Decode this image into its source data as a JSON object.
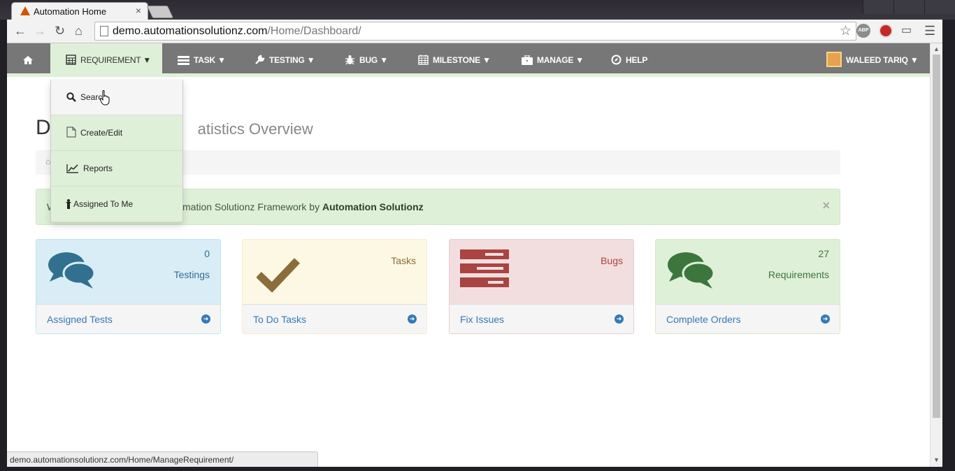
{
  "browser": {
    "tab_title": "Automation Home",
    "tab_close": "×",
    "url_host": "demo.automationsolutionz.com",
    "url_path": "/Home/Dashboard/",
    "ext_abp": "ABP",
    "status_url": "demo.automationsolutionz.com/Home/ManageRequirement/"
  },
  "nav": {
    "items": [
      {
        "label": "REQUIREMENT ▼",
        "icon": "calculator-icon"
      },
      {
        "label": "TASK ▼",
        "icon": "tasks-icon"
      },
      {
        "label": "TESTING ▼",
        "icon": "wrench-icon"
      },
      {
        "label": "BUG ▼",
        "icon": "bug-icon"
      },
      {
        "label": "MILESTONE  ▼",
        "icon": "calendar-icon"
      },
      {
        "label": "MANAGE ▼",
        "icon": "briefcase-icon"
      },
      {
        "label": "HELP",
        "icon": "compass-icon"
      }
    ],
    "user": "WALEED TARIQ ▼"
  },
  "dropdown": {
    "items": [
      {
        "label": "Search",
        "icon": "search-icon"
      },
      {
        "label": "Create/Edit",
        "icon": "file-icon"
      },
      {
        "label": "Reports",
        "icon": "line-chart-icon"
      },
      {
        "label": "Assigned To Me",
        "icon": "person-icon"
      }
    ]
  },
  "page": {
    "heading_visible": "D",
    "heading_sub_visible": "atistics Overview",
    "alert_prefix": "W",
    "alert_text": "omation Solutionz Framework by ",
    "alert_bold": "Automation Solutionz",
    "alert_close": "×"
  },
  "panels": [
    {
      "count": "0",
      "label": "Testings",
      "link": "Assigned Tests",
      "color": "#d9edf7",
      "border": "#bce8f1",
      "icon_color": "#31708f",
      "text_color": "#31708f"
    },
    {
      "count": "",
      "label": "Tasks",
      "link": "To Do Tasks",
      "color": "#fcf8e3",
      "border": "#faebcc",
      "icon_color": "#8a6d3b",
      "text_color": "#8a6d3b"
    },
    {
      "count": "",
      "label": "Bugs",
      "link": "Fix Issues",
      "color": "#f2dede",
      "border": "#ebccd1",
      "icon_color": "#a94442",
      "text_color": "#a94442"
    },
    {
      "count": "27",
      "label": "Requirements",
      "link": "Complete Orders",
      "color": "#dff0d8",
      "border": "#d6e9c6",
      "icon_color": "#3c763d",
      "text_color": "#3c763d"
    }
  ]
}
